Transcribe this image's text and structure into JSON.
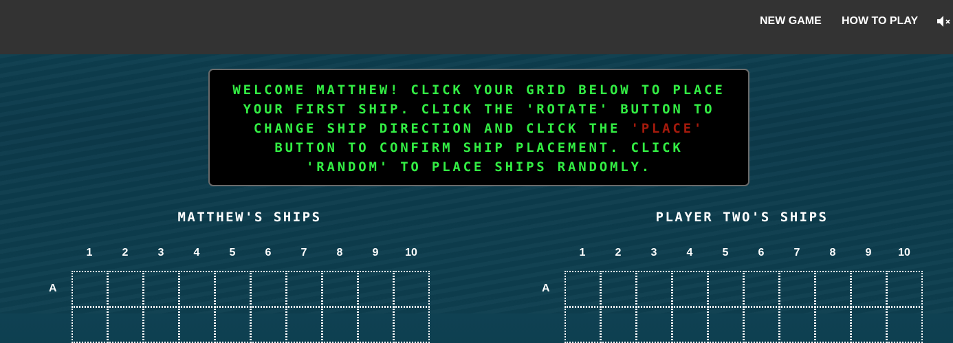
{
  "nav": {
    "new_game": "NEW GAME",
    "how_to_play": "HOW TO PLAY",
    "mute_icon": "speaker-muted-icon"
  },
  "message": {
    "lines": [
      "WELCOME MATTHEW! CLICK YOUR GRID BELOW TO PLACE",
      "YOUR FIRST SHIP. CLICK THE 'ROTATE' BUTTON TO"
    ],
    "line3_pre": "CHANGE SHIP DIRECTION AND CLICK THE ",
    "line3_red": "'PLACE'",
    "line4": "BUTTON TO CONFIRM SHIP PLACEMENT. CLICK",
    "line5": "'RANDOM' TO PLACE SHIPS RANDOMLY.",
    "color": "#33ee44",
    "highlight_color": "#a51a0c"
  },
  "boards": [
    {
      "title": "MATTHEW'S SHIPS"
    },
    {
      "title": "PLAYER TWO'S SHIPS"
    }
  ],
  "columns": [
    "1",
    "2",
    "3",
    "4",
    "5",
    "6",
    "7",
    "8",
    "9",
    "10"
  ],
  "rows": [
    "A"
  ]
}
